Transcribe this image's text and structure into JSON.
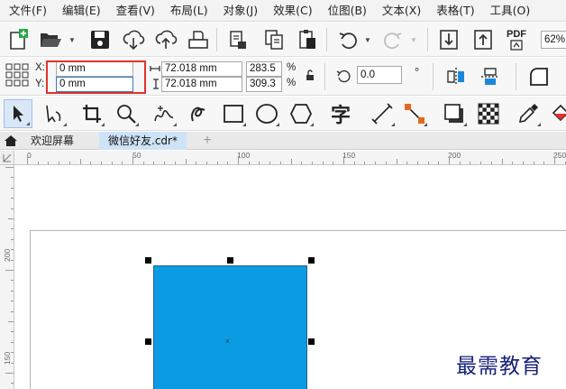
{
  "menu": [
    "文件(F)",
    "编辑(E)",
    "查看(V)",
    "布局(L)",
    "对象(J)",
    "效果(C)",
    "位图(B)",
    "文本(X)",
    "表格(T)",
    "工具(O)"
  ],
  "toolbar": {
    "pdf_label": "PDF",
    "zoom": "62%"
  },
  "propbar": {
    "x_label": "X:",
    "y_label": "Y:",
    "x_value": "0 mm",
    "y_value": "0 mm",
    "width_value": "72.018 mm",
    "height_value": "72.018 mm",
    "scale_w": "283.5",
    "scale_h": "309.3",
    "percent": "%",
    "rotation": "0.0",
    "degree": "°"
  },
  "tools": {
    "text_tool_glyph": "字"
  },
  "tabs": {
    "welcome": "欢迎屏幕",
    "document": "微信好友.cdr*",
    "add": "+"
  },
  "ruler": {
    "h_labels": [
      "0",
      "50",
      "100",
      "150",
      "200",
      "250"
    ],
    "v_labels": [
      "200",
      "150"
    ]
  },
  "watermark": "最需教育",
  "colors": {
    "shape_fill": "#0a9be3",
    "highlight": "#e0332c",
    "accent": "#3a78c9"
  }
}
